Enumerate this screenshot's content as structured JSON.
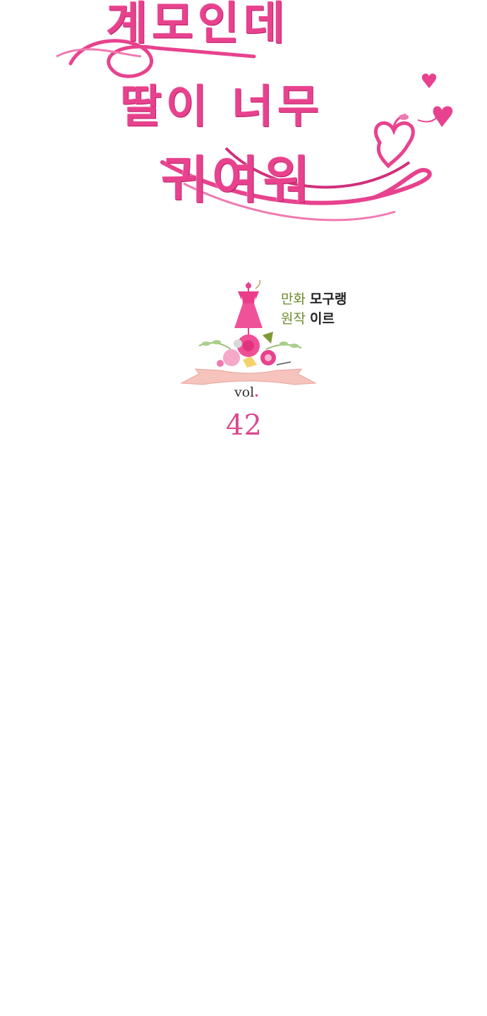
{
  "title": {
    "lines": [
      "계모인데",
      "딸이 너무",
      "귀여워"
    ]
  },
  "credits": [
    {
      "role": "만화",
      "name": "모구랭"
    },
    {
      "role": "원작",
      "name": "이르"
    }
  ],
  "volume": {
    "label": "vol",
    "dot": ".",
    "number": "42"
  },
  "colors": {
    "title_pink": "#e8428e",
    "role_green": "#6f8a2a",
    "number_pink": "#d94a91"
  },
  "icons": [
    "ribbon-swash",
    "heart-icon",
    "apple-heart-icon",
    "dress-icon",
    "flower-bouquet",
    "banner-ribbon"
  ]
}
